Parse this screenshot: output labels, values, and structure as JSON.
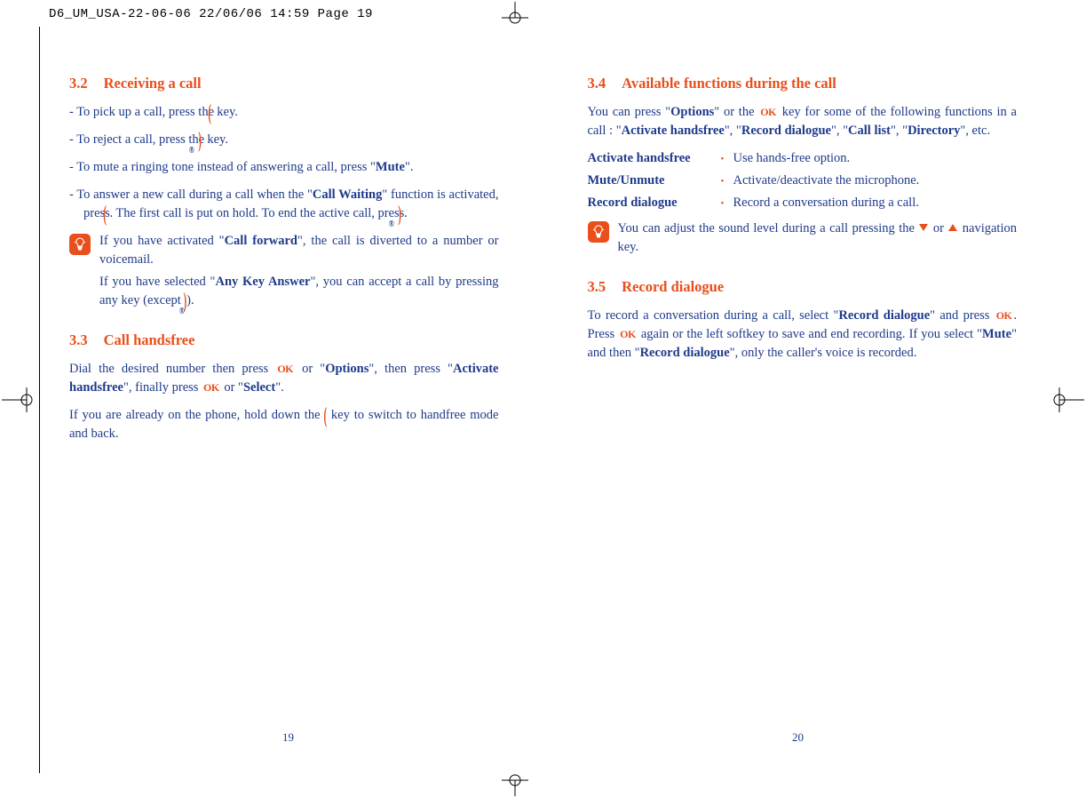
{
  "print_header": "D6_UM_USA-22-06-06  22/06/06  14:59  Page 19",
  "left": {
    "s32": {
      "num": "3.2",
      "title": "Receiving a call",
      "b1a": "To pick up a call, press the ",
      "b1b": " key.",
      "b2a": "To reject a call, press the ",
      "b2b": " key.",
      "b3a": "To mute a ringing tone instead of answering a call, press \"",
      "b3b": "Mute",
      "b3c": "\".",
      "b4a": "To answer a new call during a call when the \"",
      "b4b": "Call Waiting",
      "b4c": "\" function is activated, press ",
      "b4d": ". The first call is put on hold. To end the active call, press ",
      "b4e": ".",
      "tip1a": "If you have activated \"",
      "tip1b": "Call forward",
      "tip1c": "\", the call is diverted to a number or voicemail.",
      "tip2a": "If you have selected \"",
      "tip2b": "Any Key Answer",
      "tip2c": "\", you can accept a call by pressing any key (except ",
      "tip2d": ")."
    },
    "s33": {
      "num": "3.3",
      "title": "Call handsfree",
      "p1a": "Dial the desired number then press ",
      "p1b": " or \"",
      "p1c": "Options",
      "p1d": "\", then press \"",
      "p1e": "Activate handsfree",
      "p1f": "\", finally press ",
      "p1g": " or \"",
      "p1h": "Select",
      "p1i": "\".",
      "p2a": "If you are already on the phone, hold down the ",
      "p2b": " key to switch to handfree mode and back."
    },
    "page_num": "19"
  },
  "right": {
    "s34": {
      "num": "3.4",
      "title": "Available functions during the call",
      "p1a": "You can press \"",
      "p1b": "Options",
      "p1c": "\" or the ",
      "p1d": " key for some of the following functions in a call : \"",
      "p1e": "Activate handsfree",
      "p1f": "\", \"",
      "p1g": "Record dialogue",
      "p1h": "\", \"",
      "p1i": "Call list",
      "p1j": "\", \"",
      "p1k": "Directory",
      "p1l": "\", etc.",
      "funcs": [
        {
          "label": "Activate handsfree",
          "desc": "Use hands-free option."
        },
        {
          "label": "Mute/Unmute",
          "desc": "Activate/deactivate the microphone."
        },
        {
          "label": "Record dialogue",
          "desc": "Record a conversation during a call."
        }
      ],
      "tip1a": "You can adjust the sound level during a call pressing the ",
      "tip1b": " or ",
      "tip1c": " navigation key."
    },
    "s35": {
      "num": "3.5",
      "title": "Record dialogue",
      "p1a": "To record a conversation during a call, select \"",
      "p1b": "Record dialogue",
      "p1c": "\" and press ",
      "p1d": ". Press ",
      "p1e": " again or the left softkey to save and end recording. If you select \"",
      "p1f": "Mute",
      "p1g": "\" and then \"",
      "p1h": "Record dialogue",
      "p1i": "\", only the caller's voice is recorded."
    },
    "page_num": "20"
  }
}
